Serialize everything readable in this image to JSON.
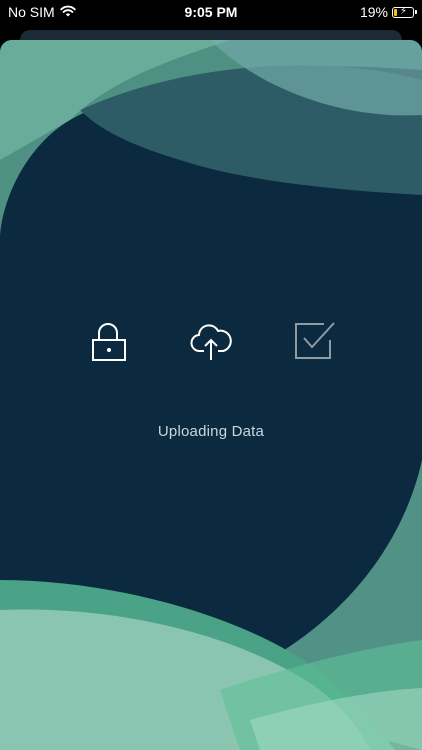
{
  "status_bar": {
    "carrier": "No SIM",
    "time": "9:05 PM",
    "battery_percent": "19%",
    "battery_level": 0.19
  },
  "upload": {
    "status_text": "Uploading Data",
    "steps": [
      {
        "icon": "lock-icon",
        "state": "active"
      },
      {
        "icon": "cloud-upload-icon",
        "state": "active"
      },
      {
        "icon": "checkbox-icon",
        "state": "pending"
      }
    ]
  },
  "colors": {
    "card_background": "#0b2a3f",
    "accent_green": "#5fbf9a",
    "accent_light": "#a8dcc6",
    "icon_active": "#ffffff",
    "icon_pending": "#8f9aa3"
  }
}
